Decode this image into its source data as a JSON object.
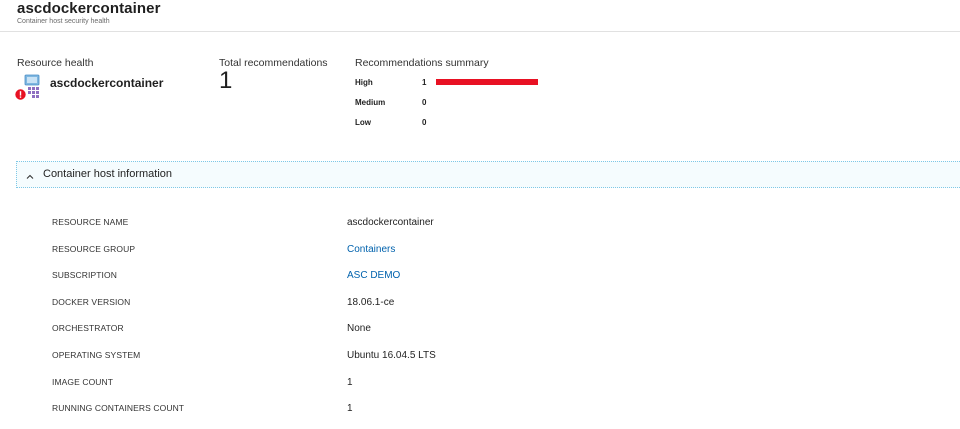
{
  "header": {
    "title": "ascdockercontainer",
    "subtitle": "Container host security health"
  },
  "resource_health": {
    "label": "Resource health",
    "name": "ascdockercontainer",
    "icon": "container-host-icon",
    "status_icon": "error-badge-icon"
  },
  "total_recommendations": {
    "label": "Total recommendations",
    "value": "1"
  },
  "summary": {
    "label": "Recommendations summary",
    "bar_color": "#e81123",
    "rows": [
      {
        "label": "High",
        "count": "1",
        "fraction": 1.0
      },
      {
        "label": "Medium",
        "count": "0",
        "fraction": 0
      },
      {
        "label": "Low",
        "count": "0",
        "fraction": 0
      }
    ]
  },
  "section": {
    "title": "Container host information",
    "icon": "chevron-up-icon",
    "rows": [
      {
        "key": "RESOURCE NAME",
        "value": "ascdockercontainer",
        "link": false
      },
      {
        "key": "RESOURCE GROUP",
        "value": "Containers",
        "link": true
      },
      {
        "key": "SUBSCRIPTION",
        "value": "ASC DEMO",
        "link": true
      },
      {
        "key": "DOCKER VERSION",
        "value": "18.06.1-ce",
        "link": false
      },
      {
        "key": "ORCHESTRATOR",
        "value": "None",
        "link": false
      },
      {
        "key": "OPERATING SYSTEM",
        "value": "Ubuntu 16.04.5 LTS",
        "link": false
      },
      {
        "key": "IMAGE COUNT",
        "value": "1",
        "link": false
      },
      {
        "key": "RUNNING CONTAINERS COUNT",
        "value": "1",
        "link": false
      }
    ]
  },
  "colors": {
    "accent_link": "#0062ad",
    "severity_high": "#e81123",
    "section_border": "#7fc8e6"
  }
}
